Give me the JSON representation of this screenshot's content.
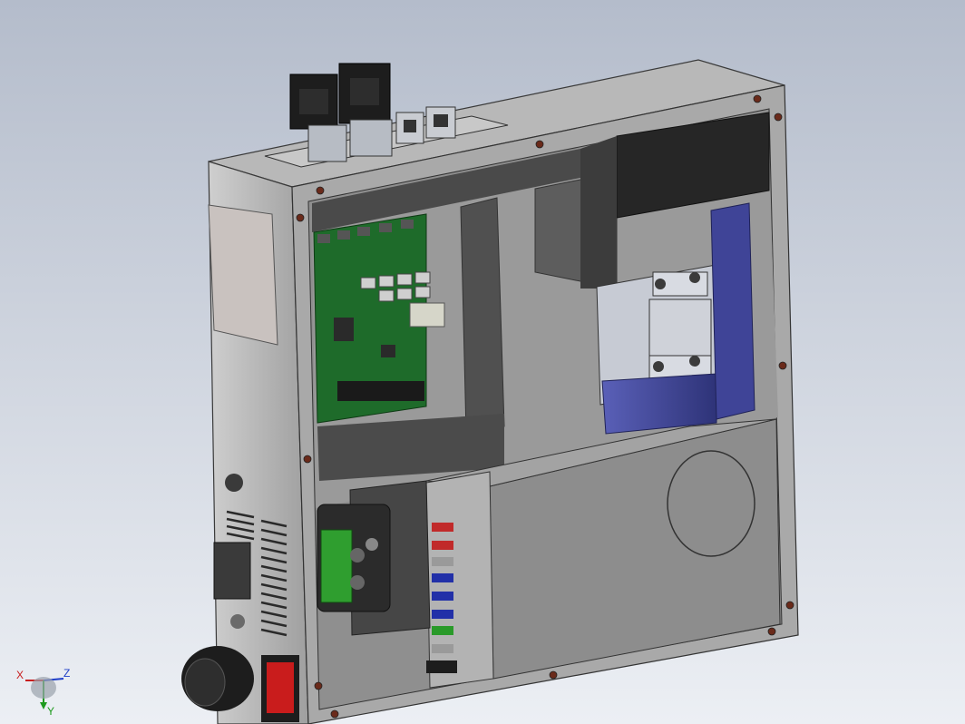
{
  "viewport": {
    "background_top": "#b4bccb",
    "background_bottom": "#eceff4"
  },
  "colors": {
    "enclosure": "#c0c0c0",
    "enclosure_dark": "#5a5a5a",
    "panel_shadow": "#3c3c3c",
    "pcb": "#1e6b2a",
    "relay_housing": "#4b52a3",
    "terminal_green": "#2f9e2f",
    "switch_red": "#c91c1c",
    "connector_black": "#1d1d1d"
  },
  "icons": {
    "triad": "axis-triad-icon"
  },
  "triad": {
    "x_label": "X",
    "y_label": "Y",
    "z_label": "Z"
  }
}
